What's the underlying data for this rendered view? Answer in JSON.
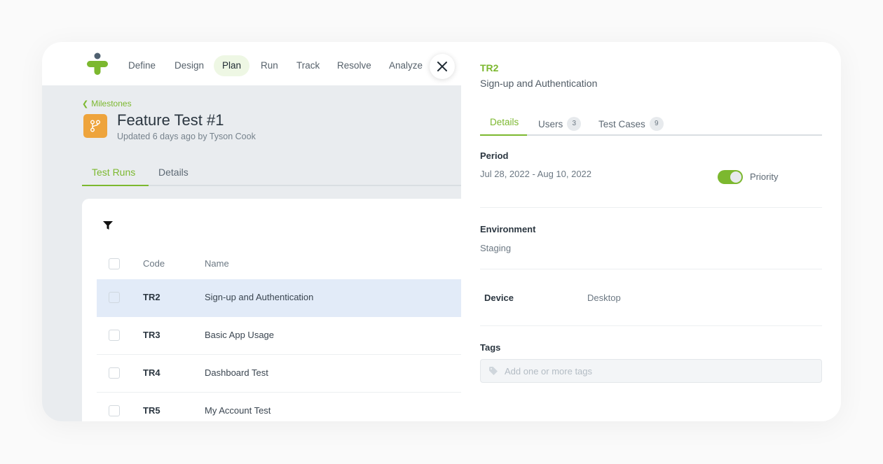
{
  "colors": {
    "accent": "#7cb82f",
    "milestone_icon": "#eea43c",
    "selected_row": "#e2ebf8",
    "logo_dot": "#4f6070"
  },
  "nav": {
    "items": [
      {
        "label": "Define",
        "active": false
      },
      {
        "label": "Design",
        "active": false
      },
      {
        "label": "Plan",
        "active": true
      },
      {
        "label": "Run",
        "active": false
      },
      {
        "label": "Track",
        "active": false
      },
      {
        "label": "Resolve",
        "active": false
      },
      {
        "label": "Analyze",
        "active": false
      }
    ],
    "close_icon": "close-icon"
  },
  "milestone": {
    "breadcrumb": "Milestones",
    "icon": "branch-icon",
    "title": "Feature Test #1",
    "subtitle": "Updated 6 days ago by Tyson Cook",
    "tabs": [
      {
        "label": "Test Runs",
        "active": true
      },
      {
        "label": "Details",
        "active": false
      }
    ]
  },
  "table": {
    "filter_icon": "filter-icon",
    "columns": {
      "code": "Code",
      "name": "Name"
    },
    "rows": [
      {
        "code": "TR2",
        "name": "Sign-up and Authentication",
        "selected": true
      },
      {
        "code": "TR3",
        "name": "Basic App Usage",
        "selected": false
      },
      {
        "code": "TR4",
        "name": "Dashboard Test",
        "selected": false
      },
      {
        "code": "TR5",
        "name": "My Account Test",
        "selected": false
      }
    ]
  },
  "detail": {
    "code": "TR2",
    "name": "Sign-up and Authentication",
    "tabs": [
      {
        "label": "Details",
        "active": true,
        "count": null
      },
      {
        "label": "Users",
        "active": false,
        "count": "3"
      },
      {
        "label": "Test Cases",
        "active": false,
        "count": "9"
      }
    ],
    "period_label": "Period",
    "period_value": "Jul 28, 2022 - Aug 10, 2022",
    "priority_label": "Priority",
    "priority_on": true,
    "environment_label": "Environment",
    "environment_value": "Staging",
    "device_label": "Device",
    "device_value": "Desktop",
    "tags_label": "Tags",
    "tags_placeholder": "Add one or more tags",
    "tags_value": ""
  }
}
